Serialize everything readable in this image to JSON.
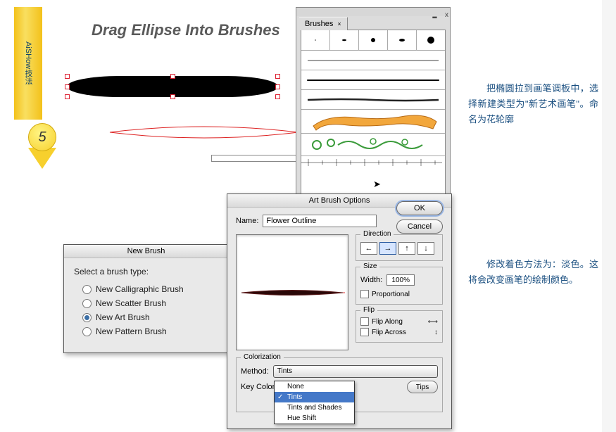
{
  "ribbon": {
    "text": "AiSHow技法",
    "step": "5"
  },
  "heading": "Drag Ellipse Into Brushes",
  "side_text_1": "把椭圆拉到画笔调板中，选择新建类型为\"新艺术画笔\"。命名为花轮廓",
  "side_text_2": "修改着色方法为：淡色。这将会改变画笔的绘制颜色。",
  "brushes_panel": {
    "tab": "Brushes",
    "close": "x",
    "min": "▁▁"
  },
  "new_brush": {
    "title": "New Brush",
    "label": "Select a brush type:",
    "options": {
      "calligraphic": "New Calligraphic Brush",
      "scatter": "New Scatter Brush",
      "art": "New Art Brush",
      "pattern": "New Pattern Brush"
    },
    "selected": "art"
  },
  "art_brush": {
    "title": "Art Brush Options",
    "name_label": "Name:",
    "name_value": "Flower Outline",
    "ok": "OK",
    "cancel": "Cancel",
    "direction": {
      "title": "Direction",
      "arrows": [
        "←",
        "→",
        "↑",
        "↓"
      ],
      "selected": 1
    },
    "size": {
      "title": "Size",
      "width_label": "Width:",
      "width_value": "100%",
      "proportional": "Proportional"
    },
    "flip": {
      "title": "Flip",
      "along": "Flip Along",
      "across": "Flip Across"
    },
    "colorization": {
      "title": "Colorization",
      "method_label": "Method:",
      "key_label": "Key Color:",
      "tips": "Tips",
      "options": {
        "none": "None",
        "tints": "Tints",
        "tints_shades": "Tints and Shades",
        "hue_shift": "Hue Shift"
      },
      "selected": "tints"
    }
  }
}
